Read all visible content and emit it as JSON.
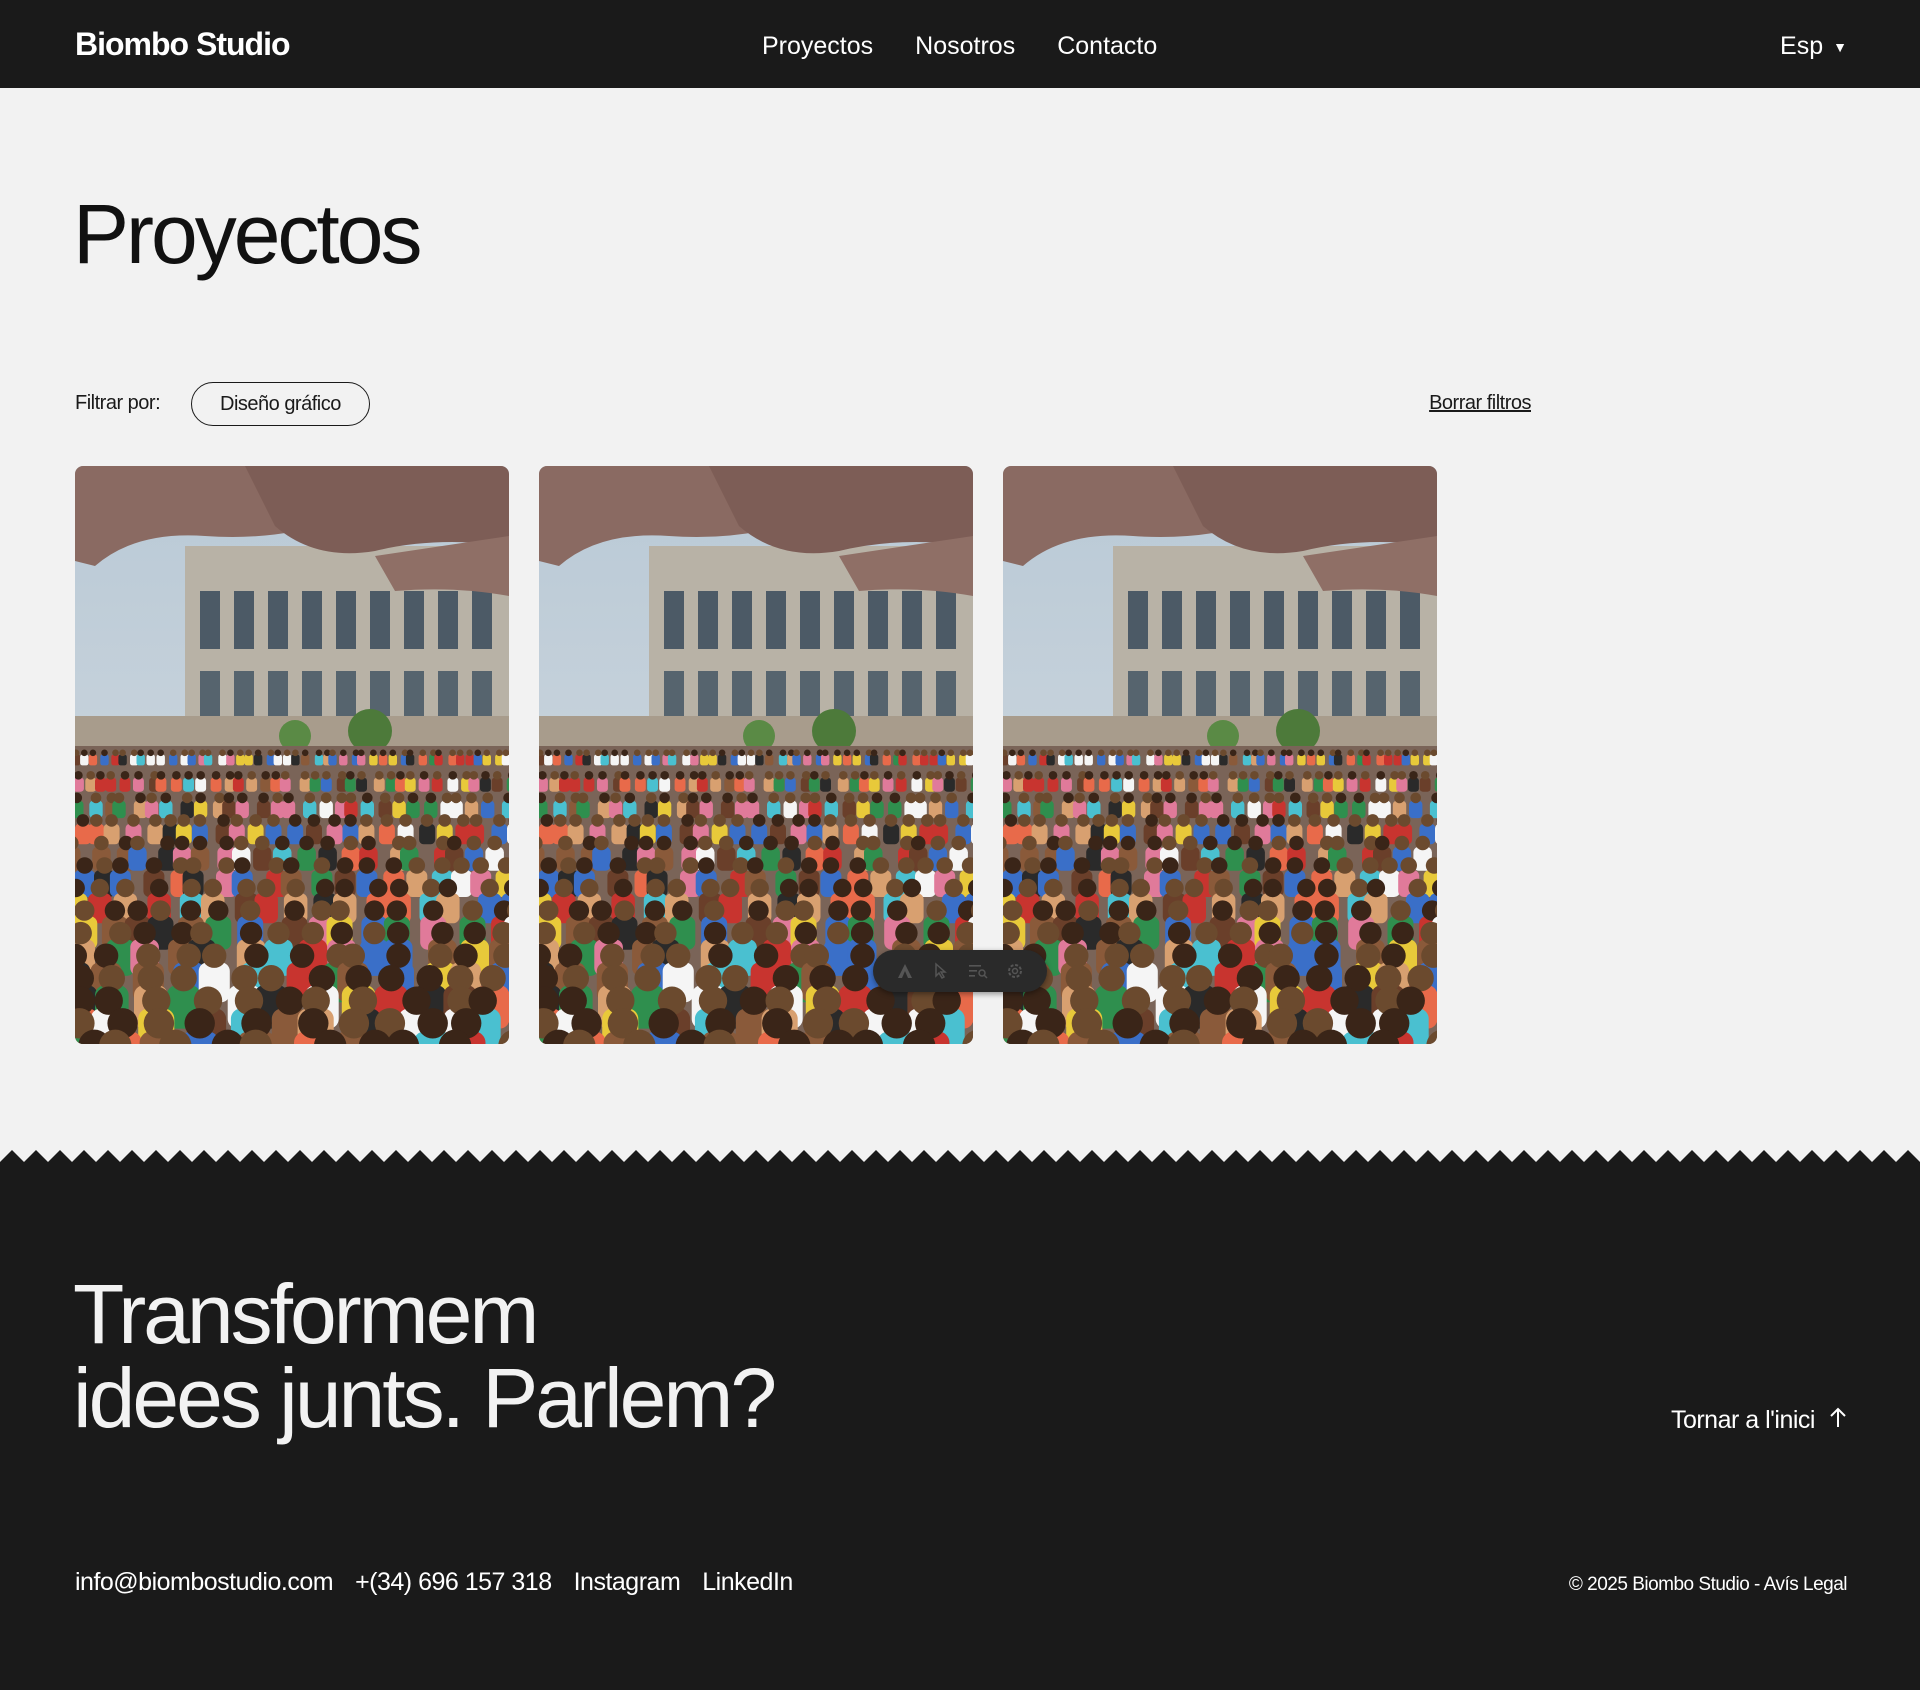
{
  "header": {
    "logo": "Biombo Studio",
    "nav": [
      "Proyectos",
      "Nosotros",
      "Contacto"
    ],
    "language": "Esp"
  },
  "main": {
    "title": "Proyectos",
    "filter": {
      "label": "Filtrar por:",
      "active_chip": "Diseño gráfico",
      "clear_label": "Borrar filtros"
    },
    "projects": [
      {
        "image": "crowd-at-outdoor-event-photo"
      },
      {
        "image": "crowd-at-outdoor-event-photo"
      },
      {
        "image": "crowd-at-outdoor-event-photo"
      }
    ]
  },
  "toolbar": {
    "icons": [
      "logo-icon",
      "cursor-icon",
      "inspect-list-icon",
      "gear-icon"
    ]
  },
  "footer": {
    "cta_line1": "Transformem",
    "cta_line2": "idees junts. Parlem?",
    "back_to_top": "Tornar a l'inici",
    "email": "info@biombostudio.com",
    "phone": "+(34) 696 157 318",
    "instagram": "Instagram",
    "linkedin": "LinkedIn",
    "copyright": "© 2025 Biombo Studio - Avís Legal"
  },
  "colors": {
    "dark": "#1a1a1a",
    "light": "#f2f2f2"
  }
}
